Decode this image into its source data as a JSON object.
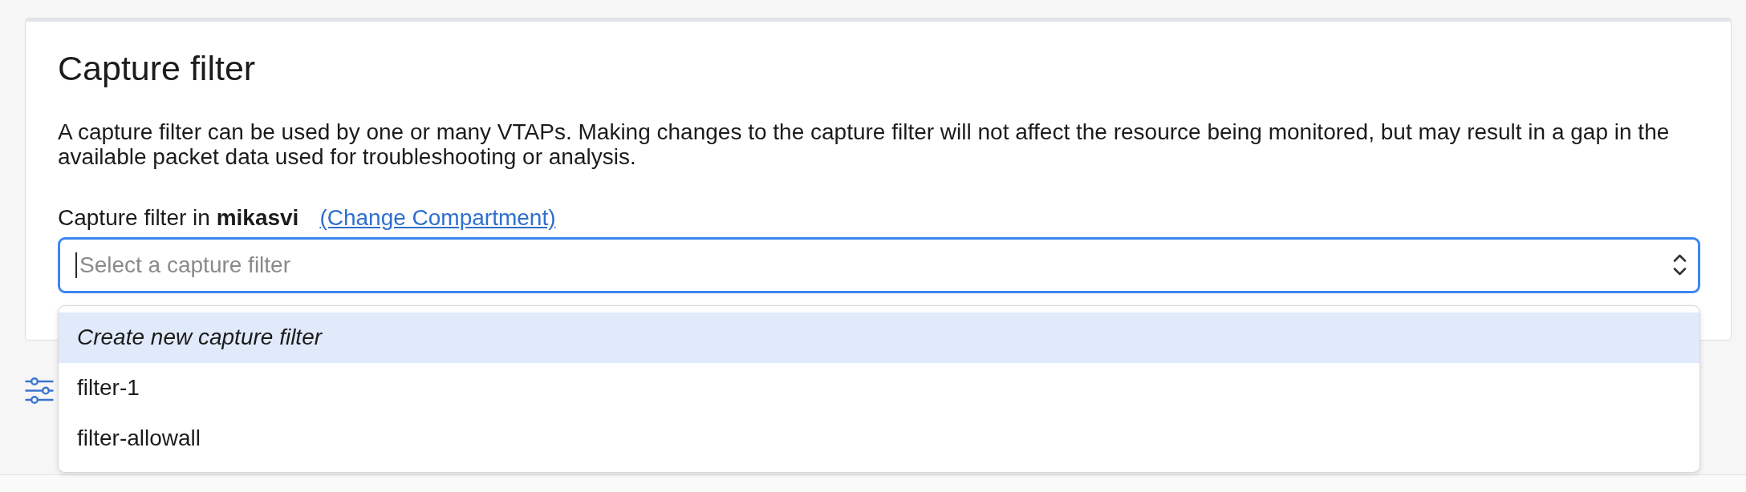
{
  "panel": {
    "title": "Capture filter",
    "description": "A capture filter can be used by one or many VTAPs. Making changes to the capture filter will not affect the resource being monitored, but may result in a gap in the available packet data used for troubleshooting or analysis."
  },
  "field": {
    "label": "Capture filter in **mikasvi**",
    "link": "(Change Compartment)",
    "placeholder": "Select a capture filter",
    "focused": true,
    "expanded": true,
    "options": [
      {
        "kind": "action",
        "label": "Create new capture filter",
        "selected": true
      },
      {
        "kind": "option",
        "label": "filter-1",
        "selected": false
      },
      {
        "kind": "option",
        "label": "filter-allowall",
        "selected": false
      }
    ]
  }
}
